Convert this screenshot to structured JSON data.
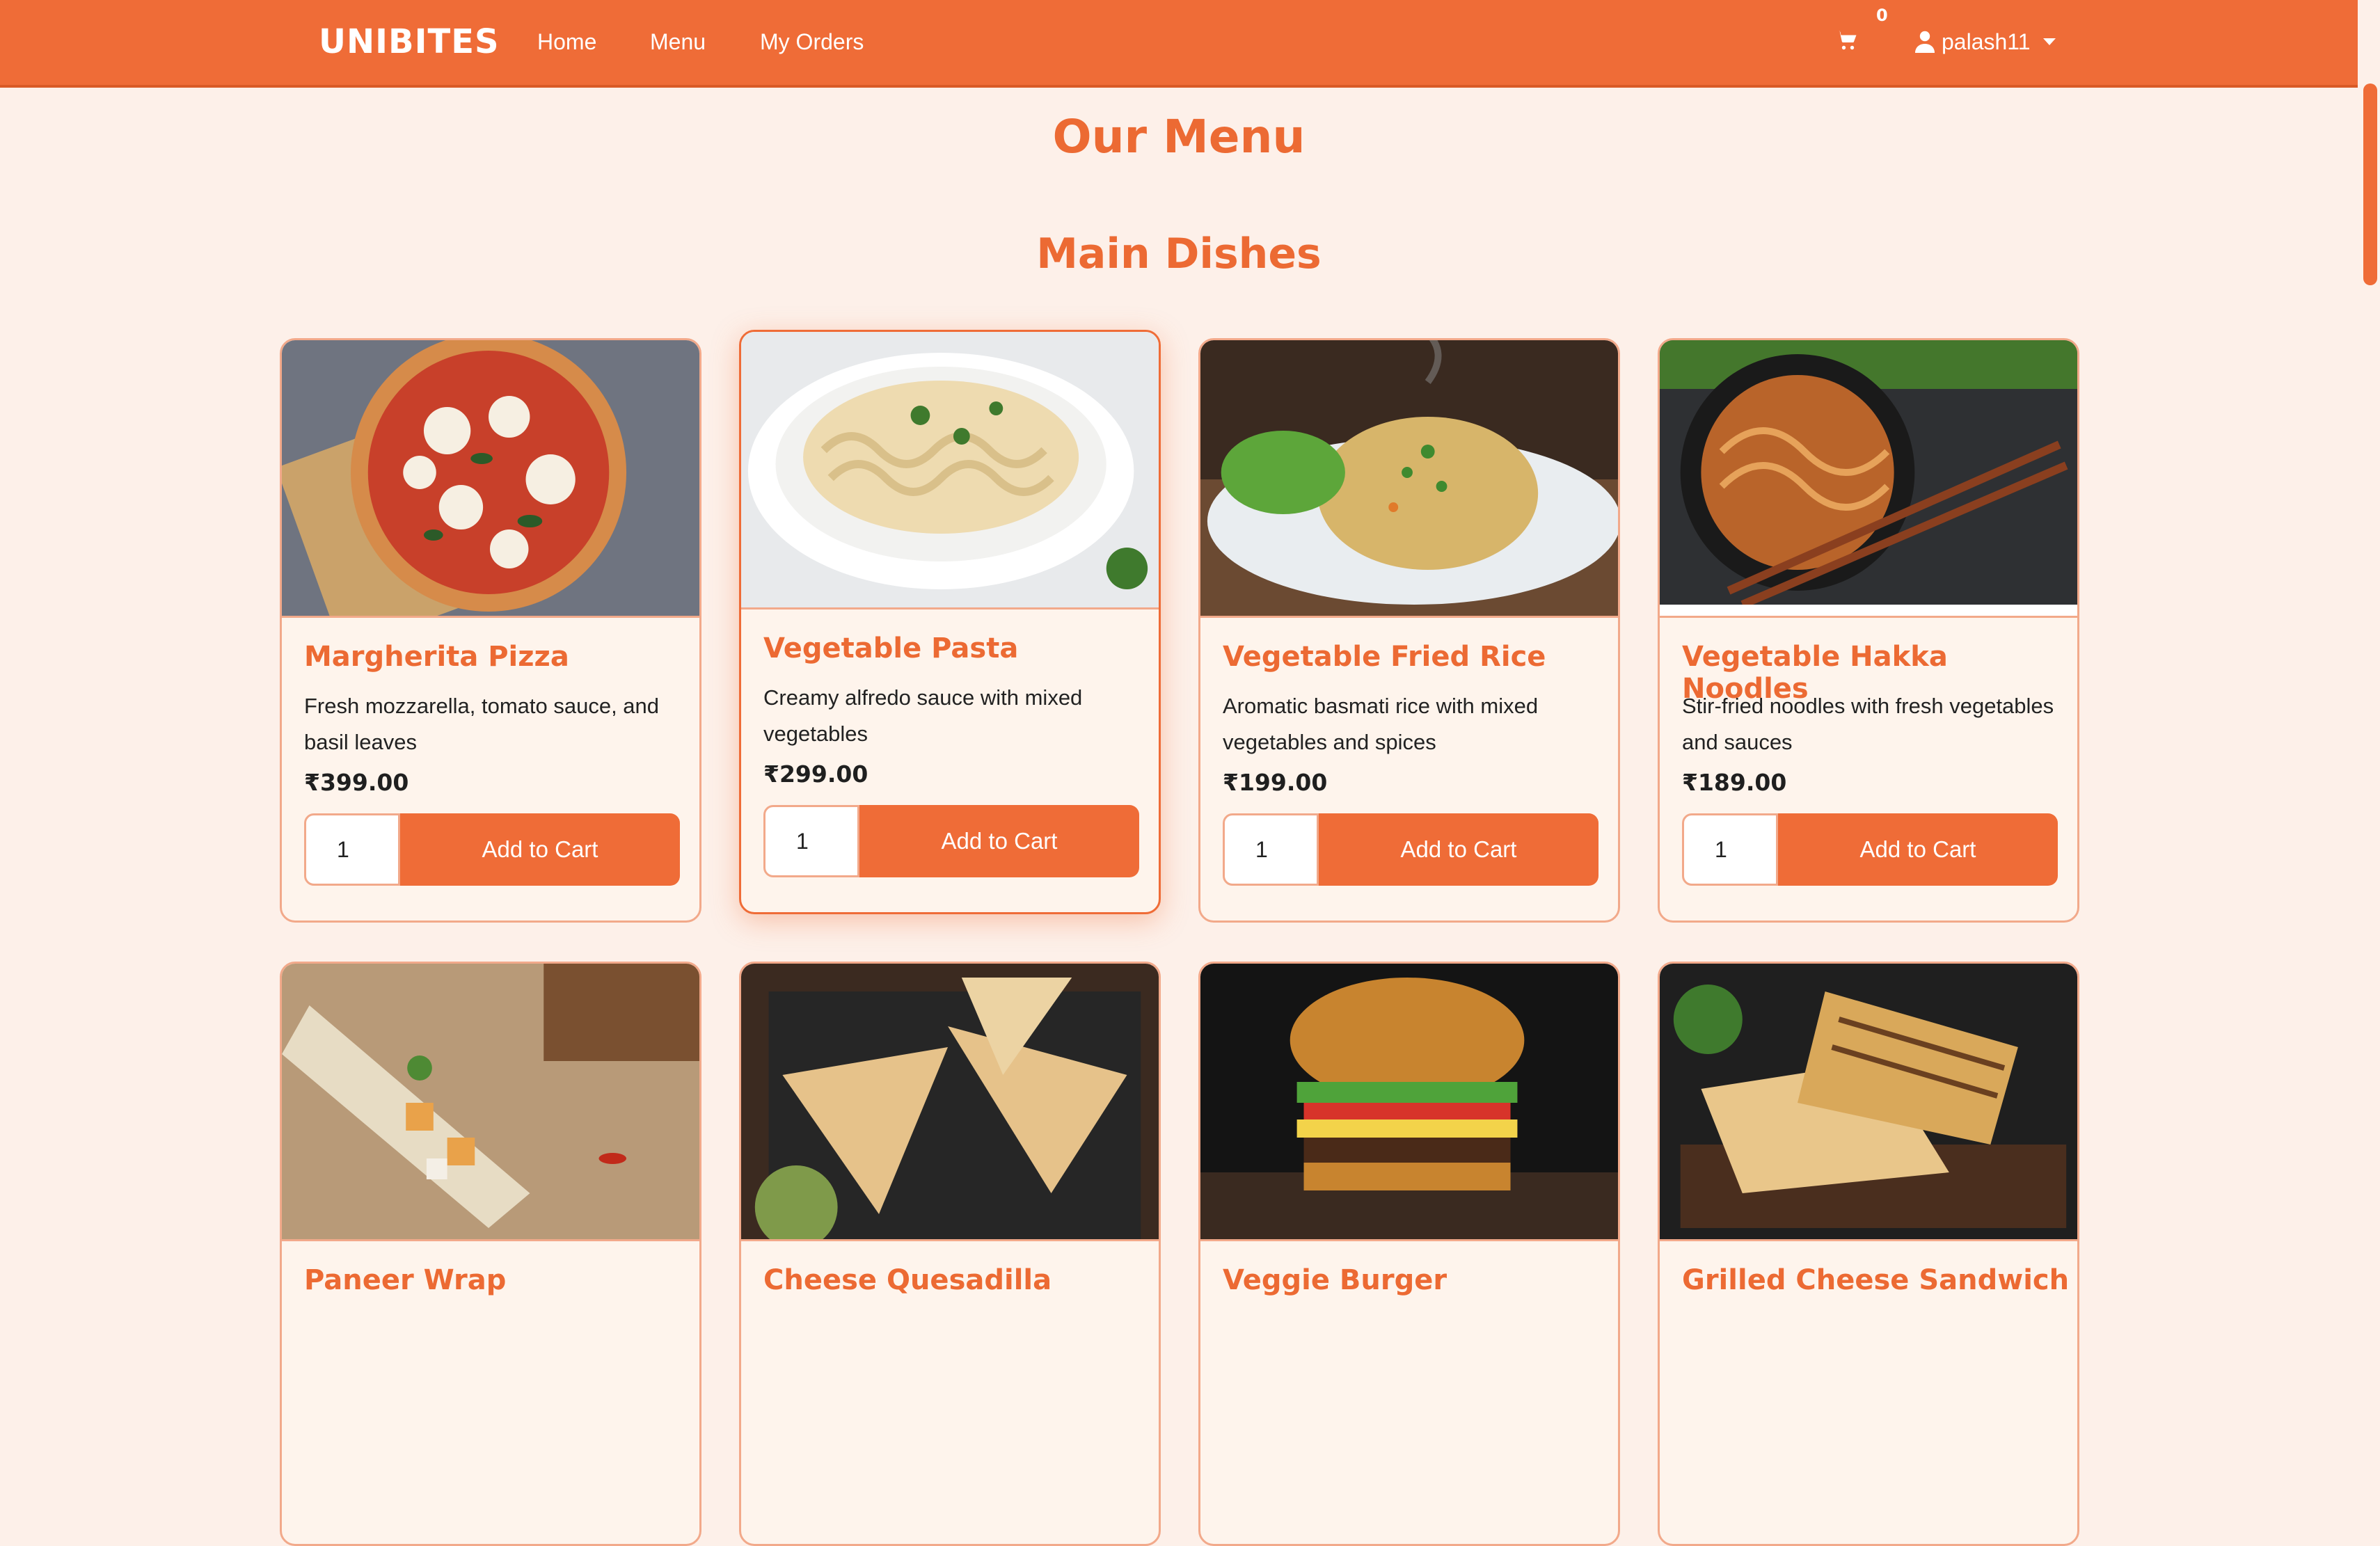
{
  "brand": "UNIBITES",
  "nav": {
    "home": "Home",
    "menu": "Menu",
    "orders": "My Orders"
  },
  "cart": {
    "count": "0",
    "icon": "cart-icon"
  },
  "user": {
    "name": "palash11",
    "icon": "user-icon"
  },
  "colors": {
    "primary": "#ef6c37",
    "background": "#fdf0e9",
    "card": "#fef4ec"
  },
  "page_title": "Our Menu",
  "section_title": "Main Dishes",
  "add_label": "Add to Cart",
  "items": [
    {
      "name": "Margherita Pizza",
      "desc": "Fresh mozzarella, tomato sauce, and basil leaves",
      "price": "₹399.00",
      "qty": "1"
    },
    {
      "name": "Vegetable Pasta",
      "desc": "Creamy alfredo sauce with mixed vegetables",
      "price": "₹299.00",
      "qty": "1"
    },
    {
      "name": "Vegetable Fried Rice",
      "desc": "Aromatic basmati rice with mixed vegetables and spices",
      "price": "₹199.00",
      "qty": "1"
    },
    {
      "name": "Vegetable Hakka Noodles",
      "desc": "Stir-fried noodles with fresh vegetables and sauces",
      "price": "₹189.00",
      "qty": "1"
    },
    {
      "name": "Paneer Wrap"
    },
    {
      "name": "Cheese Quesadilla"
    },
    {
      "name": "Veggie Burger"
    },
    {
      "name": "Grilled Cheese Sandwich"
    }
  ]
}
